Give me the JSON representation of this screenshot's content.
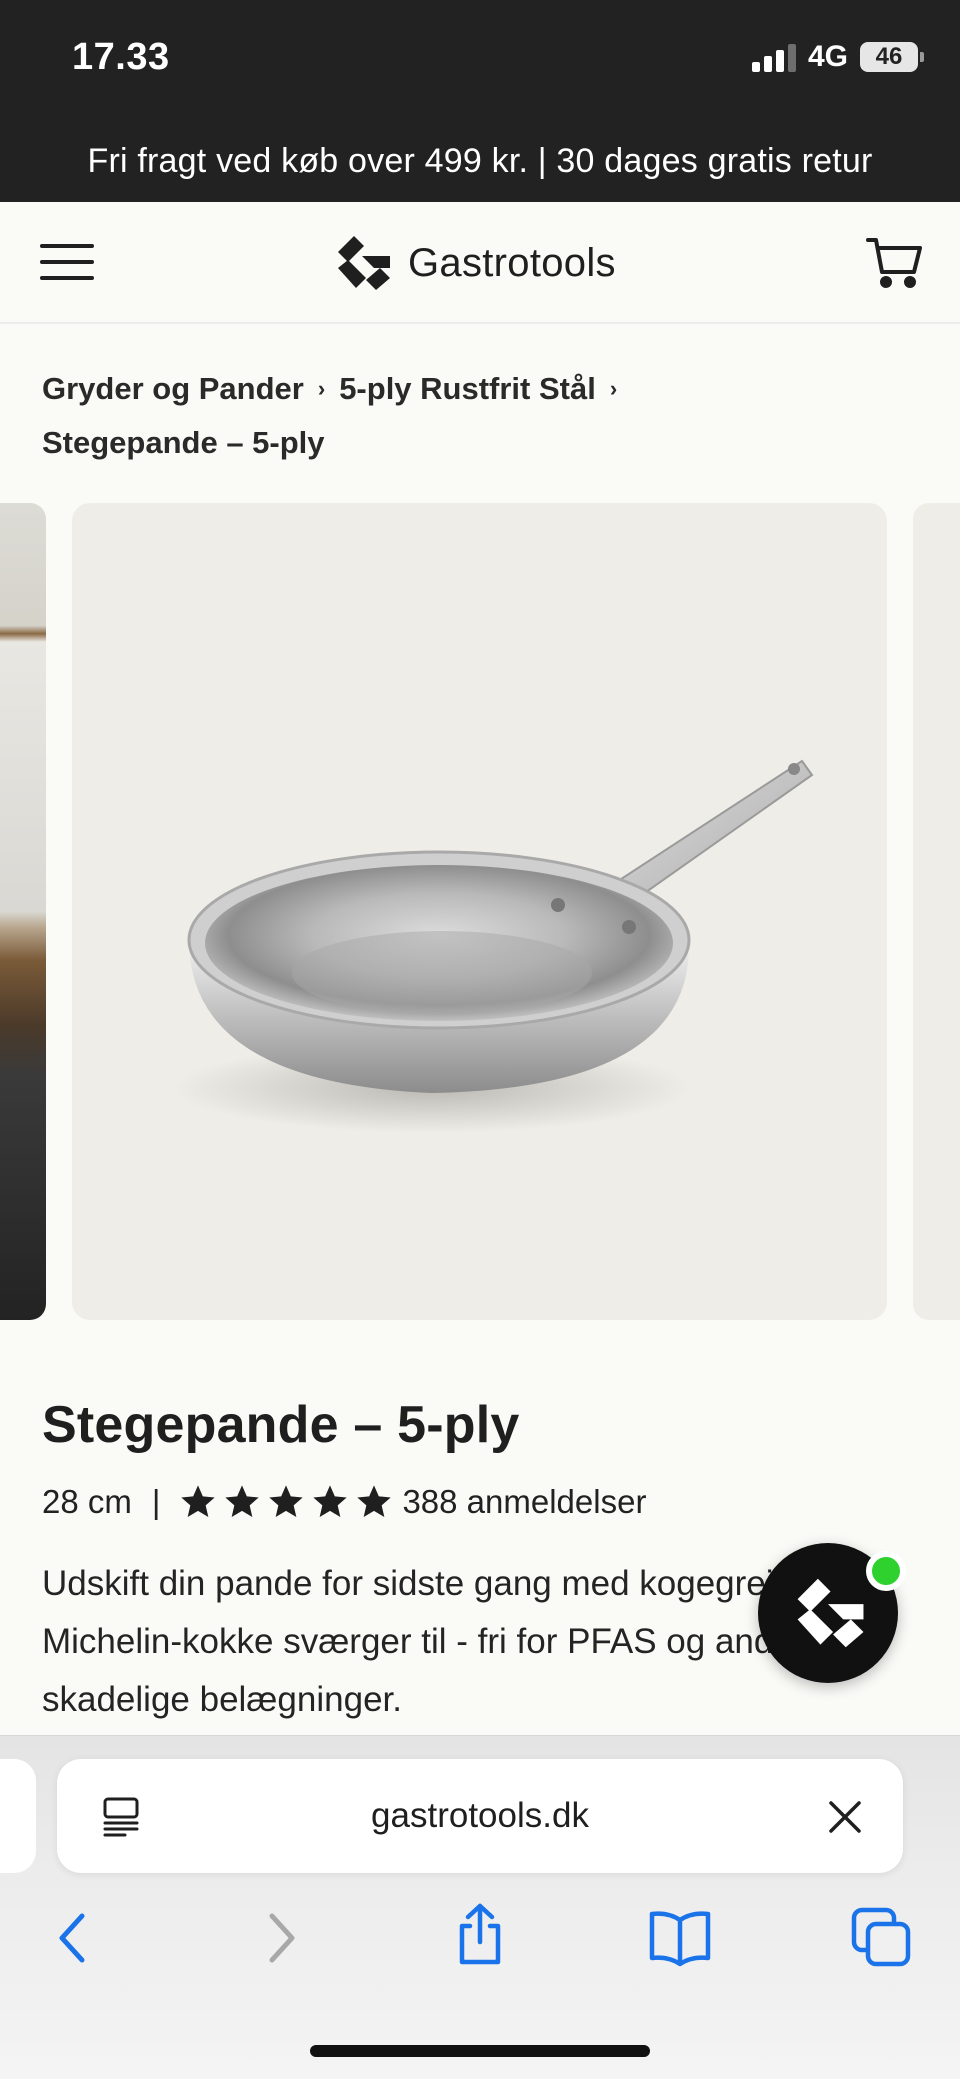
{
  "status_bar": {
    "time": "17.33",
    "network": "4G",
    "battery": "46",
    "signal_bars": 3
  },
  "promo": {
    "text": "Fri fragt ved køb over 499 kr. | 30 dages gratis retur"
  },
  "header": {
    "brand_name": "Gastrotools",
    "menu_icon": "hamburger-menu-icon",
    "cart_icon": "shopping-cart-icon"
  },
  "breadcrumb": {
    "items": [
      "Gryder og Pander",
      "5-ply Rustfrit Stål",
      "Stegepande – 5-ply"
    ],
    "separator": "›"
  },
  "gallery": {
    "main_image": "stainless-steel-frying-pan"
  },
  "product": {
    "title": "Stegepande – 5-ply",
    "size": "28 cm",
    "meta_separator": "|",
    "rating": 5,
    "reviews": "388 anmeldelser",
    "description": "Udskift din pande for sidste gang med kogegrejet, Michelin-kokke sværger til - fri for PFAS og andre skadelige belægninger."
  },
  "browser": {
    "url": "gastrotools.dk",
    "reader_icon": "reader-mode-icon",
    "clear_icon": "close-icon",
    "toolbar": [
      "back-icon",
      "forward-icon",
      "share-icon",
      "bookmarks-icon",
      "tabs-icon"
    ]
  },
  "colors": {
    "dark_bar": "#222222",
    "page_bg": "#fafaf7",
    "link_blue": "#1a73e8",
    "online_green": "#2fd12f"
  }
}
